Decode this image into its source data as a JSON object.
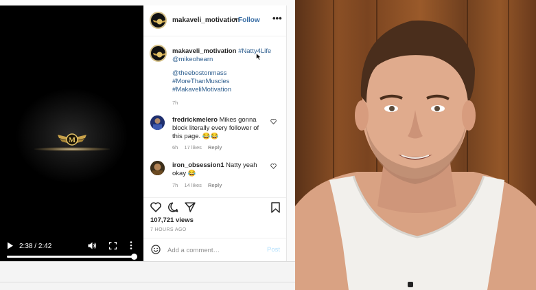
{
  "colors": {
    "accent_link": "#3a6ea5",
    "hashtag": "#2f5f8f",
    "muted": "#8e8e8e",
    "post_disabled": "#b2dffc",
    "logo_gold": "#d6c28a"
  },
  "video": {
    "current_time": "2:38",
    "separator": " / ",
    "duration": "2:42",
    "progress": 0.977,
    "icons": [
      "play-icon",
      "volume-icon",
      "fullscreen-icon",
      "more-vertical-icon"
    ]
  },
  "post": {
    "username": "makaveli_motivation",
    "dot": "•",
    "follow_label": "Follow",
    "more_label": "•••",
    "caption": {
      "username": "makaveli_motivation",
      "tag_main": "#Natty4Life",
      "mention_1": "@mikeohearn",
      "mention_2": "@theebostonmass",
      "tag_2": "#MoreThanMuscles",
      "tag_3": "#MakaveliMotivation",
      "time": "7h"
    },
    "comments": [
      {
        "username": "fredrickmelero",
        "line1": "Mikes gonna",
        "line2": "block literally every follower of",
        "line3": "this page. 😂😂",
        "time": "6h",
        "likes": "17 likes",
        "reply": "Reply"
      },
      {
        "username": "iron_obsession1",
        "line1": "Natty yeah",
        "line2": "okay 😂",
        "time": "7h",
        "likes": "14 likes",
        "reply": "Reply"
      }
    ],
    "views": "107,721 views",
    "time_ago": "7 HOURS AGO",
    "comment_placeholder": "Add a comment…",
    "post_label": "Post"
  }
}
